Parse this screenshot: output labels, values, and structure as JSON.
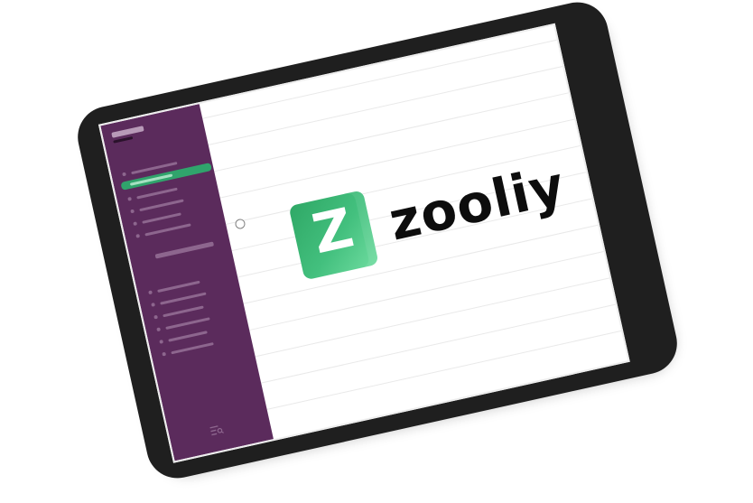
{
  "brand": {
    "name": "zooliy",
    "mark_letter": "Z",
    "accent_color": "#30a46c",
    "sidebar_color": "#5b2b5c",
    "device_color": "#1f1f1f"
  },
  "icons": {
    "sidebar_toggle": "circle-toggle-icon",
    "sidebar_footer": "list-search-icon"
  }
}
